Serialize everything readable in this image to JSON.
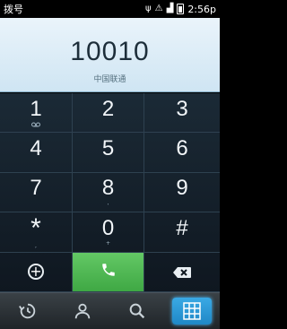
{
  "status_bar": {
    "title": "拨号",
    "time": "2:56p",
    "icons": [
      "usb-icon",
      "debug-icon",
      "signal-icon",
      "battery-icon"
    ]
  },
  "display": {
    "number": "10010",
    "carrier": "中国联通"
  },
  "keypad": {
    "keys": [
      {
        "digit": "1",
        "sub": "voicemail-icon"
      },
      {
        "digit": "2",
        "sub": ""
      },
      {
        "digit": "3",
        "sub": ""
      },
      {
        "digit": "4",
        "sub": ""
      },
      {
        "digit": "5",
        "sub": ""
      },
      {
        "digit": "6",
        "sub": ""
      },
      {
        "digit": "7",
        "sub": ""
      },
      {
        "digit": "8",
        "sub": ","
      },
      {
        "digit": "9",
        "sub": ""
      },
      {
        "digit": "*",
        "sub": ","
      },
      {
        "digit": "0",
        "sub": "+"
      },
      {
        "digit": "#",
        "sub": ""
      }
    ],
    "actions": [
      "add-contact-icon",
      "call-icon",
      "delete-icon"
    ],
    "call_color": "#4fb851"
  },
  "tabs": [
    {
      "name": "recent-calls",
      "icon": "history-icon",
      "active": false
    },
    {
      "name": "contacts",
      "icon": "person-icon",
      "active": false
    },
    {
      "name": "search",
      "icon": "search-icon",
      "active": false
    },
    {
      "name": "dialpad",
      "icon": "dialpad-icon",
      "active": true
    }
  ],
  "colors": {
    "accent": "#2b9ad8",
    "display_bg": "#dcecf7"
  }
}
